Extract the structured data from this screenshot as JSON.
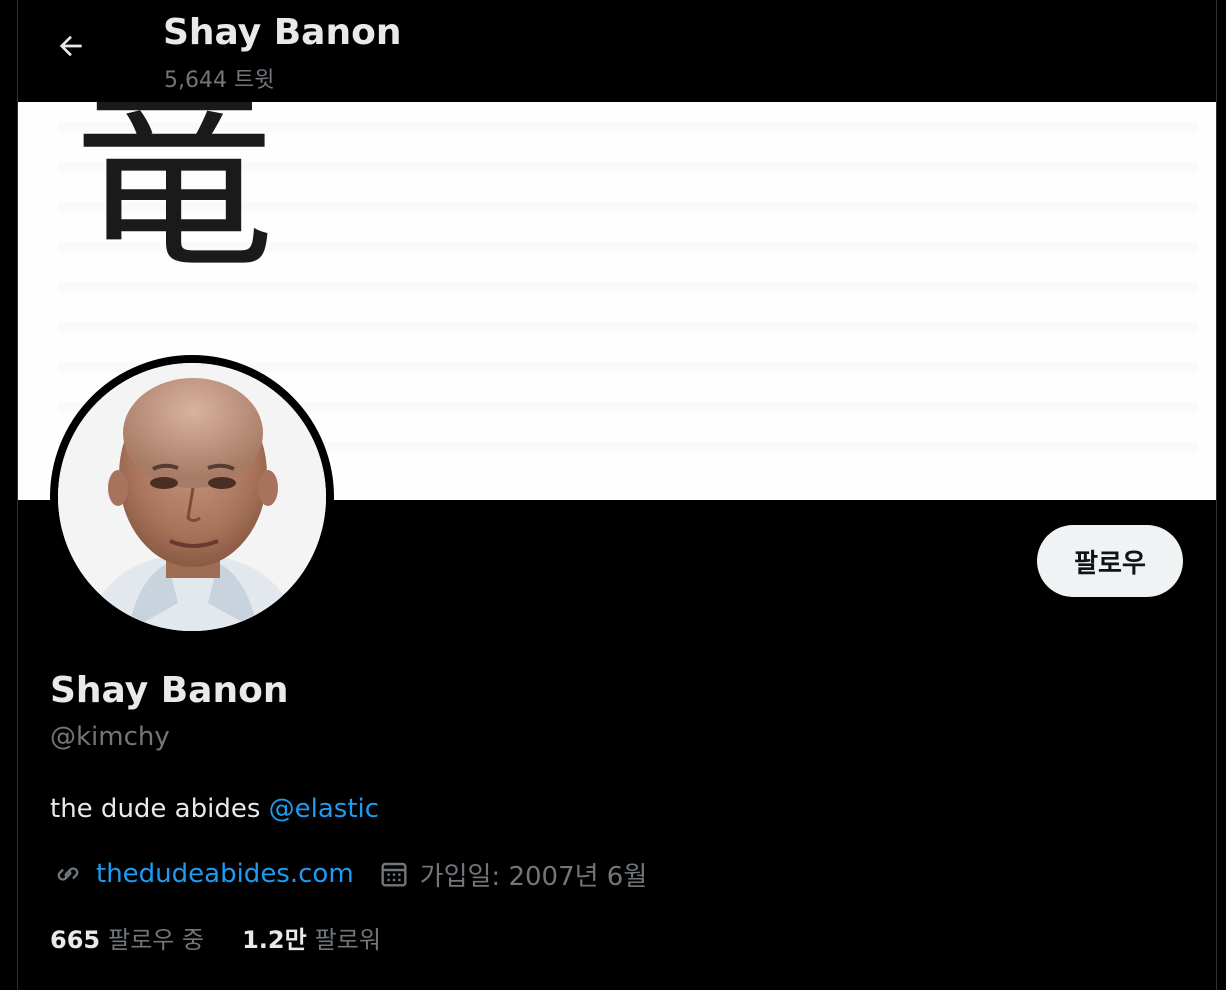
{
  "header": {
    "title": "Shay Banon",
    "tweet_count": "5,644 트윗",
    "back_icon": "arrow-left-icon"
  },
  "banner": {
    "glyph": "竜"
  },
  "profile": {
    "name": "Shay Banon",
    "handle": "@kimchy",
    "bio_text": "the dude abides ",
    "bio_mention": "@elastic",
    "website": "thedudeabides.com",
    "joined": "가입일: 2007년 6월",
    "follow_label": "팔로우",
    "following_count": "665",
    "following_label": "팔로우 중",
    "followers_count": "1.2만",
    "followers_label": "팔로워"
  },
  "colors": {
    "accent": "#1d9bf0",
    "muted": "#71767b",
    "text": "#e7e9ea",
    "background": "#000000"
  }
}
